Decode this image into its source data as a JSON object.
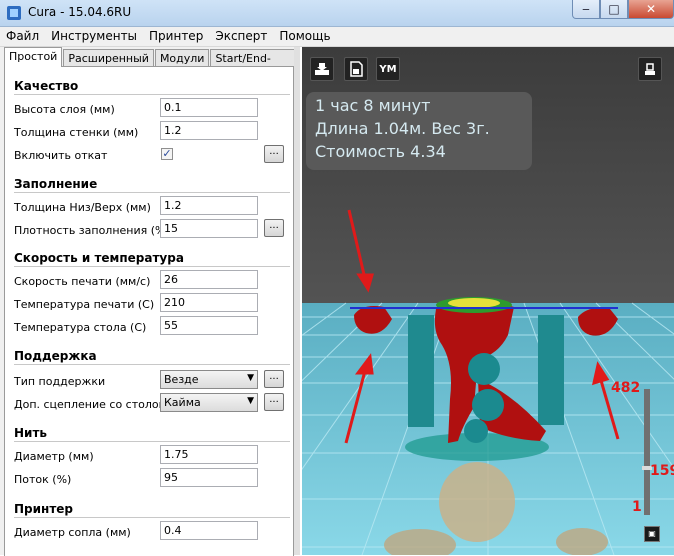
{
  "window": {
    "title": "Cura - 15.04.6RU",
    "minimize": "‒",
    "maximize": "□",
    "close": "✕"
  },
  "menu": [
    "Файл",
    "Инструменты",
    "Принтер",
    "Эксперт",
    "Помощь"
  ],
  "tabs": [
    "Простой",
    "Расширенный",
    "Модули",
    "Start/End-GCode"
  ],
  "sections": {
    "quality": {
      "title": "Качество",
      "layer_height_label": "Высота слоя (мм)",
      "layer_height": "0.1",
      "wall_label": "Толщина стенки (мм)",
      "wall": "1.2",
      "retraction_label": "Включить откат",
      "retraction_checked": true
    },
    "fill": {
      "title": "Заполнение",
      "bottom_top_label": "Толщина Низ/Верх (мм)",
      "bottom_top": "1.2",
      "density_label": "Плотность заполнения (%)",
      "density": "15"
    },
    "speed": {
      "title": "Скорость и температура",
      "print_speed_label": "Скорость печати (мм/с)",
      "print_speed": "26",
      "print_temp_label": "Температура печати (С)",
      "print_temp": "210",
      "bed_temp_label": "Температура стола (С)",
      "bed_temp": "55"
    },
    "support": {
      "title": "Поддержка",
      "type_label": "Тип поддержки",
      "type": "Везде",
      "adhesion_label": "Доп. сцепление со столом",
      "adhesion": "Кайма"
    },
    "filament": {
      "title": "Нить",
      "diameter_label": "Диаметр (мм)",
      "diameter": "1.75",
      "flow_label": "Поток (%)",
      "flow": "95"
    },
    "machine": {
      "title": "Принтер",
      "nozzle_label": "Диаметр сопла (мм)",
      "nozzle": "0.4"
    }
  },
  "dots_label": "...",
  "viewer": {
    "info": [
      "1 час 8 минут",
      "Длина 1.04м. Вес 3г.",
      "Стоимость 4.34"
    ],
    "ym_label": "YM",
    "layer_max": "482",
    "layer_current": "159",
    "layer_min": "1"
  },
  "colors": {
    "plate": "#7ecfe0",
    "model": "#b01010",
    "support": "#1a8a8f",
    "arrow": "#e01a1a"
  }
}
